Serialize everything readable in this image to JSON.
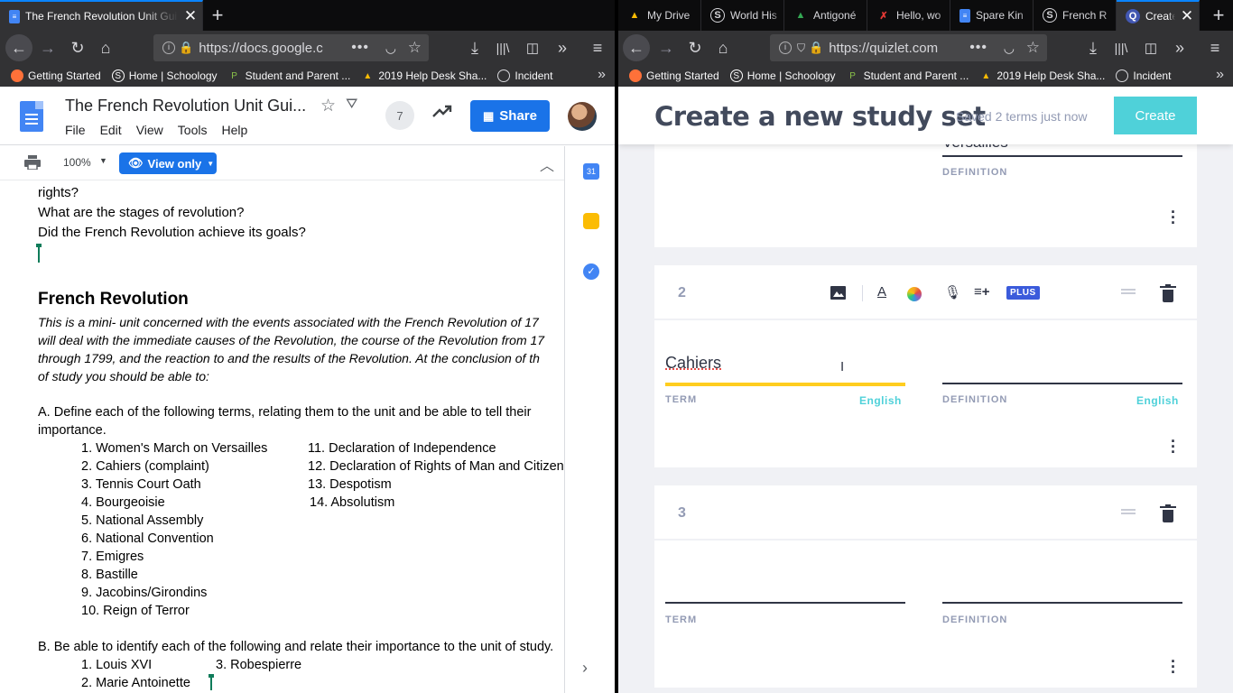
{
  "left_browser": {
    "tabs": [
      {
        "title": "The French Revolution Unit Gui",
        "active": true,
        "icon": "docs-icon"
      }
    ],
    "url": "https://docs.google.c",
    "bookmarks": [
      "Getting Started",
      "Home | Schoology",
      "Student and Parent ...",
      "2019 Help Desk Sha...",
      "Incident"
    ]
  },
  "right_browser": {
    "tabs": [
      {
        "title": "My Drive",
        "icon": "drive-icon"
      },
      {
        "title": "World His",
        "icon": "schoology-icon"
      },
      {
        "title": "Antigoné",
        "icon": "drive-icon"
      },
      {
        "title": "Hello, wo",
        "icon": "red-figure-icon"
      },
      {
        "title": "Spare Kin",
        "icon": "docs-icon"
      },
      {
        "title": "French R",
        "icon": "schoology-icon"
      },
      {
        "title": "Create",
        "icon": "quizlet-icon",
        "active": true
      }
    ],
    "url": "https://quizlet.com",
    "bookmarks": [
      "Getting Started",
      "Home | Schoology",
      "Student and Parent ...",
      "2019 Help Desk Sha...",
      "Incident"
    ]
  },
  "docs": {
    "title": "The French Revolution Unit Gui...",
    "menu": [
      "File",
      "Edit",
      "View",
      "Tools",
      "Help"
    ],
    "collaborators": "7",
    "share_label": "Share",
    "zoom": "100%",
    "mode": "View only",
    "body": {
      "lines_top": [
        "rights?",
        "What are the stages of revolution?",
        "Did the French Revolution achieve its goals?"
      ],
      "heading": "French Revolution",
      "intro": [
        "This is a mini- unit concerned with the events associated with the French Revolution of 17",
        "will deal with the immediate causes of the Revolution, the course of the Revolution from 17",
        "through 1799, and the reaction to and the results of the Revolution. At the conclusion of th",
        "of study you should be able to:"
      ],
      "section_a": [
        "A.  Define each of the following terms, relating them to the unit and be able to tell their",
        "importance."
      ],
      "terms_left": [
        "1. Women's March on Versailles",
        "2.  Cahiers (complaint)",
        "3.  Tennis Court Oath",
        "4.  Bourgeoisie",
        "5.  National Assembly",
        "6.  National Convention",
        "7.   Emigres",
        "8.  Bastille",
        "9. Jacobins/Girondins",
        "10.  Reign of Terror"
      ],
      "terms_right": [
        "11. Declaration of Independence",
        "12.  Declaration of Rights of Man and Citizen",
        "13.  Despotism",
        "14. Absolutism"
      ],
      "section_b": "B.  Be able to identify each of the following and relate their importance to the unit of study.",
      "people_left": [
        "1.  Louis XVI",
        "2.  Marie Antoinette"
      ],
      "people_right": [
        "3.  Robespierre"
      ]
    }
  },
  "quizlet": {
    "heading": "Create a new study set",
    "saved_status": "Saved 2 terms just now",
    "create_label": "Create",
    "card1": {
      "definition_partial": "Versailles",
      "definition_label": "DEFINITION"
    },
    "card2": {
      "number": "2",
      "term_value": "Cahiers",
      "term_label": "TERM",
      "definition_label": "DEFINITION",
      "term_lang": "English",
      "def_lang": "English",
      "plus_badge": "PLUS"
    },
    "card3": {
      "number": "3",
      "term_label": "TERM",
      "definition_label": "DEFINITION"
    }
  }
}
